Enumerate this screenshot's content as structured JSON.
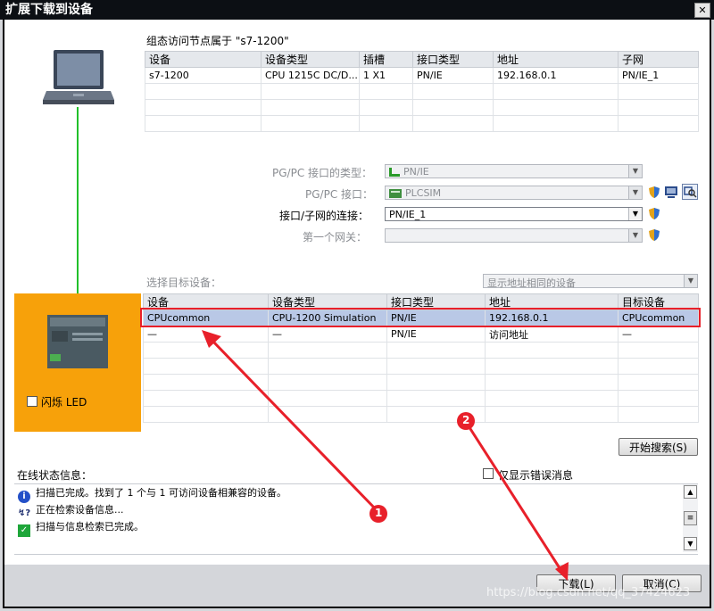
{
  "window": {
    "title": "扩展下载到设备",
    "close_symbol": "✕"
  },
  "config_nodes": {
    "heading": "组态访问节点属于 \"s7-1200\"",
    "columns": [
      "设备",
      "设备类型",
      "插槽",
      "接口类型",
      "地址",
      "子网"
    ],
    "rows": [
      [
        "s7-1200",
        "CPU 1215C DC/D...",
        "1 X1",
        "PN/IE",
        "192.168.0.1",
        "PN/IE_1"
      ]
    ]
  },
  "pgpc": {
    "type_label": "PG/PC 接口的类型：",
    "type_value": "PN/IE",
    "interface_label": "PG/PC 接口：",
    "interface_value": "PLCSIM",
    "connection_label": "接口/子网的连接：",
    "connection_value": "PN/IE_1",
    "gateway_label": "第一个网关："
  },
  "target": {
    "select_label": "选择目标设备：",
    "filter_value": "显示地址相同的设备",
    "columns": [
      "设备",
      "设备类型",
      "接口类型",
      "地址",
      "目标设备"
    ],
    "rows": [
      [
        "CPUcommon",
        "CPU-1200 Simulation",
        "PN/IE",
        "192.168.0.1",
        "CPUcommon"
      ],
      [
        "—",
        "—",
        "PN/IE",
        "访问地址",
        "—"
      ]
    ]
  },
  "flash_led_label": "闪烁 LED",
  "start_search_label": "开始搜索(S)",
  "online_status": {
    "label": "在线状态信息：",
    "show_errors_label": "仅显示错误消息",
    "messages": [
      {
        "icon": "info-icon",
        "text": "扫描已完成。找到了 1 个与 1 可访问设备相兼容的设备。"
      },
      {
        "icon": "search-device-icon",
        "text": "正在检索设备信息..."
      },
      {
        "icon": "check-icon",
        "text": "扫描与信息检索已完成。"
      }
    ]
  },
  "buttons": {
    "download": "下载(L)",
    "cancel": "取消(C)"
  },
  "annotations": {
    "marker1": "1",
    "marker2": "2"
  },
  "watermark": "https://blog.csdn.net/qq_37424623",
  "colors": {
    "accent_orange": "#f7a10a",
    "highlight_red": "#e8202a",
    "selection_blue": "#b9c8e6",
    "link_green": "#22c02a"
  }
}
